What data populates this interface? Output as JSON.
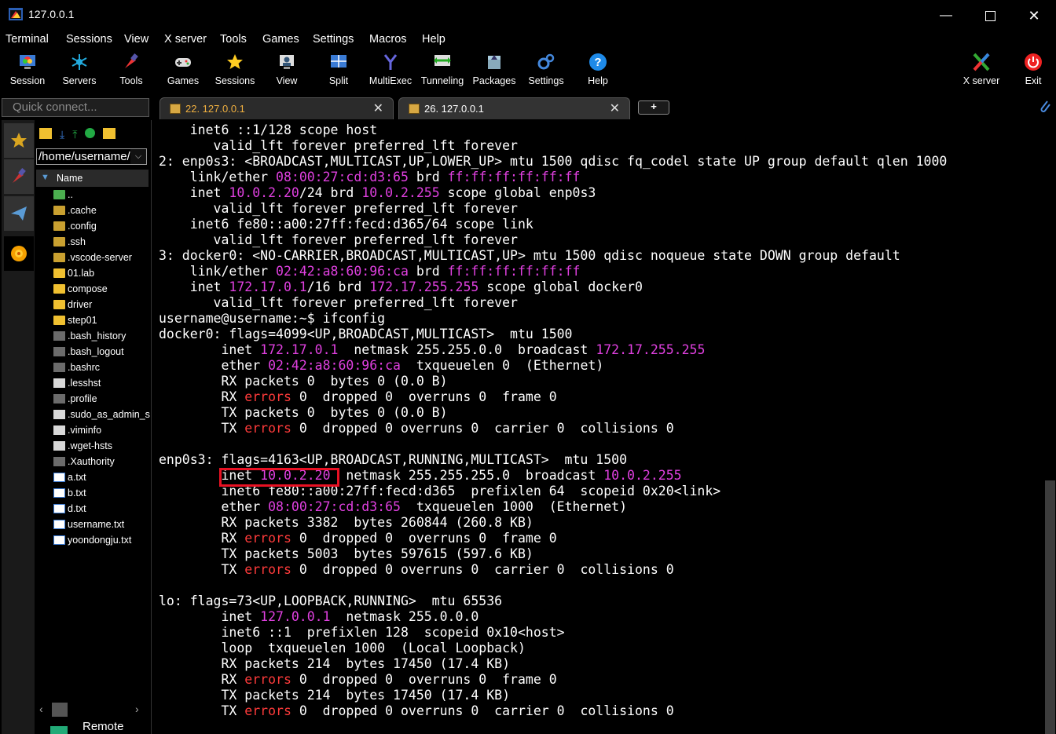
{
  "window": {
    "title": "127.0.0.1"
  },
  "menu": [
    "Terminal",
    "Sessions",
    "View",
    "X server",
    "Tools",
    "Games",
    "Settings",
    "Macros",
    "Help"
  ],
  "toolbar": {
    "left": [
      {
        "label": "Session",
        "icon": "session-icon"
      },
      {
        "label": "Servers",
        "icon": "servers-icon"
      },
      {
        "label": "Tools",
        "icon": "tools-icon"
      },
      {
        "label": "Games",
        "icon": "games-icon"
      },
      {
        "label": "Sessions",
        "icon": "sessions-star-icon"
      },
      {
        "label": "View",
        "icon": "view-icon"
      },
      {
        "label": "Split",
        "icon": "split-icon"
      },
      {
        "label": "MultiExec",
        "icon": "multiexec-icon"
      },
      {
        "label": "Tunneling",
        "icon": "tunneling-icon"
      },
      {
        "label": "Packages",
        "icon": "packages-icon"
      },
      {
        "label": "Settings",
        "icon": "settings-icon"
      },
      {
        "label": "Help",
        "icon": "help-icon"
      }
    ],
    "right": [
      {
        "label": "X server",
        "icon": "xserver-icon"
      },
      {
        "label": "Exit",
        "icon": "power-icon"
      }
    ]
  },
  "quick_connect": {
    "placeholder": "Quick connect..."
  },
  "tabs": [
    {
      "label": "22. 127.0.0.1",
      "close": "✕"
    },
    {
      "label": "26. 127.0.0.1",
      "close": "✕"
    }
  ],
  "new_tab": "+",
  "file_browser": {
    "path": "/home/username/",
    "column": "Name",
    "files": [
      {
        "name": "..",
        "kind": "up"
      },
      {
        "name": ".cache",
        "kind": "hfolder"
      },
      {
        "name": ".config",
        "kind": "hfolder"
      },
      {
        "name": ".ssh",
        "kind": "hfolder"
      },
      {
        "name": ".vscode-server",
        "kind": "hfolder"
      },
      {
        "name": "01.lab",
        "kind": "folder"
      },
      {
        "name": "compose",
        "kind": "folder"
      },
      {
        "name": "driver",
        "kind": "folder"
      },
      {
        "name": "step01",
        "kind": "folder"
      },
      {
        "name": ".bash_history",
        "kind": "hfile"
      },
      {
        "name": ".bash_logout",
        "kind": "hfile"
      },
      {
        "name": ".bashrc",
        "kind": "hfile"
      },
      {
        "name": ".lesshst",
        "kind": "dfile"
      },
      {
        "name": ".profile",
        "kind": "hfile"
      },
      {
        "name": ".sudo_as_admin_s",
        "kind": "dfile"
      },
      {
        "name": ".viminfo",
        "kind": "dfile"
      },
      {
        "name": ".wget-hsts",
        "kind": "dfile"
      },
      {
        "name": ".Xauthority",
        "kind": "hfile"
      },
      {
        "name": "a.txt",
        "kind": "txt"
      },
      {
        "name": "b.txt",
        "kind": "txt"
      },
      {
        "name": "d.txt",
        "kind": "txt"
      },
      {
        "name": "username.txt",
        "kind": "txt"
      },
      {
        "name": "yoondongju.txt",
        "kind": "txt"
      }
    ],
    "bottom_label": "Remote"
  },
  "terminal": {
    "lines": [
      [
        [
          "    inet6 ::1/128 scope host",
          ""
        ]
      ],
      [
        [
          "       valid_lft forever preferred_lft forever",
          ""
        ]
      ],
      [
        [
          "2: enp0s3: <BROADCAST,MULTICAST,UP,LOWER_UP> mtu 1500 qdisc fq_codel state UP group default qlen 1000",
          ""
        ]
      ],
      [
        [
          "    link/ether ",
          ""
        ],
        [
          "08:00:27:cd:d3:65",
          "mg"
        ],
        [
          " brd ",
          ""
        ],
        [
          "ff:ff:ff:ff:ff:ff",
          "mg"
        ]
      ],
      [
        [
          "    inet ",
          ""
        ],
        [
          "10.0.2.20",
          "mg"
        ],
        [
          "/24 brd ",
          ""
        ],
        [
          "10.0.2.255",
          "mg"
        ],
        [
          " scope global enp0s3",
          ""
        ]
      ],
      [
        [
          "       valid_lft forever preferred_lft forever",
          ""
        ]
      ],
      [
        [
          "    inet6 fe80::a00:27ff:fecd:d365/64 scope link",
          ""
        ]
      ],
      [
        [
          "       valid_lft forever preferred_lft forever",
          ""
        ]
      ],
      [
        [
          "3: docker0: <NO-CARRIER,BROADCAST,MULTICAST,UP> mtu 1500 qdisc noqueue state DOWN group default",
          ""
        ]
      ],
      [
        [
          "    link/ether ",
          ""
        ],
        [
          "02:42:a8:60:96:ca",
          "mg"
        ],
        [
          " brd ",
          ""
        ],
        [
          "ff:ff:ff:ff:ff:ff",
          "mg"
        ]
      ],
      [
        [
          "    inet ",
          ""
        ],
        [
          "172.17.0.1",
          "mg"
        ],
        [
          "/16 brd ",
          ""
        ],
        [
          "172.17.255.255",
          "mg"
        ],
        [
          " scope global docker0",
          ""
        ]
      ],
      [
        [
          "       valid_lft forever preferred_lft forever",
          ""
        ]
      ],
      [
        [
          "username@username:~$ ifconfig",
          ""
        ]
      ],
      [
        [
          "docker0: flags=4099<UP,BROADCAST,MULTICAST>  mtu 1500",
          ""
        ]
      ],
      [
        [
          "        inet ",
          ""
        ],
        [
          "172.17.0.1",
          "mg"
        ],
        [
          "  netmask 255.255.0.0  broadcast ",
          ""
        ],
        [
          "172.17.255.255",
          "mg"
        ]
      ],
      [
        [
          "        ether ",
          ""
        ],
        [
          "02:42:a8:60:96:ca",
          "mg"
        ],
        [
          "  txqueuelen 0  (Ethernet)",
          ""
        ]
      ],
      [
        [
          "        RX packets 0  bytes 0 (0.0 B)",
          ""
        ]
      ],
      [
        [
          "        RX ",
          ""
        ],
        [
          "errors",
          "rd"
        ],
        [
          " 0  dropped 0  overruns 0  frame 0",
          ""
        ]
      ],
      [
        [
          "        TX packets 0  bytes 0 (0.0 B)",
          ""
        ]
      ],
      [
        [
          "        TX ",
          ""
        ],
        [
          "errors",
          "rd"
        ],
        [
          " 0  dropped 0 overruns 0  carrier 0  collisions 0",
          ""
        ]
      ],
      [
        [
          "",
          ""
        ]
      ],
      [
        [
          "enp0s3: flags=4163<UP,BROADCAST,RUNNING,MULTICAST>  mtu 1500",
          ""
        ]
      ],
      [
        [
          "        inet ",
          ""
        ],
        [
          "10.0.2.20",
          "mg"
        ],
        [
          "  netmask 255.255.255.0  broadcast ",
          ""
        ],
        [
          "10.0.2.255",
          "mg"
        ]
      ],
      [
        [
          "        inet6 fe80::a00:27ff:fecd:d365  prefixlen 64  scopeid 0x20<link>",
          ""
        ]
      ],
      [
        [
          "        ether ",
          ""
        ],
        [
          "08:00:27:cd:d3:65",
          "mg"
        ],
        [
          "  txqueuelen 1000  (Ethernet)",
          ""
        ]
      ],
      [
        [
          "        RX packets 3382  bytes 260844 (260.8 KB)",
          ""
        ]
      ],
      [
        [
          "        RX ",
          ""
        ],
        [
          "errors",
          "rd"
        ],
        [
          " 0  dropped 0  overruns 0  frame 0",
          ""
        ]
      ],
      [
        [
          "        TX packets 5003  bytes 597615 (597.6 KB)",
          ""
        ]
      ],
      [
        [
          "        TX ",
          ""
        ],
        [
          "errors",
          "rd"
        ],
        [
          " 0  dropped 0 overruns 0  carrier 0  collisions 0",
          ""
        ]
      ],
      [
        [
          "",
          ""
        ]
      ],
      [
        [
          "lo: flags=73<UP,LOOPBACK,RUNNING>  mtu 65536",
          ""
        ]
      ],
      [
        [
          "        inet ",
          ""
        ],
        [
          "127.0.0.1",
          "mg"
        ],
        [
          "  netmask 255.0.0.0",
          ""
        ]
      ],
      [
        [
          "        inet6 ::1  prefixlen 128  scopeid 0x10<host>",
          ""
        ]
      ],
      [
        [
          "        loop  txqueuelen 1000  (Local Loopback)",
          ""
        ]
      ],
      [
        [
          "        RX packets 214  bytes 17450 (17.4 KB)",
          ""
        ]
      ],
      [
        [
          "        RX ",
          ""
        ],
        [
          "errors",
          "rd"
        ],
        [
          " 0  dropped 0  overruns 0  frame 0",
          ""
        ]
      ],
      [
        [
          "        TX packets 214  bytes 17450 (17.4 KB)",
          ""
        ]
      ],
      [
        [
          "        TX ",
          ""
        ],
        [
          "errors",
          "rd"
        ],
        [
          " 0  dropped 0 overruns 0  carrier 0  collisions 0",
          ""
        ]
      ]
    ]
  },
  "colors": {
    "magenta": "#e040e0",
    "red": "#ff3b3b",
    "highlight_box": "#e81123"
  }
}
